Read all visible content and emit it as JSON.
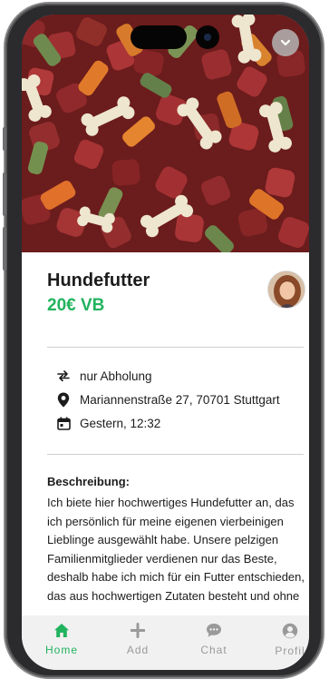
{
  "product": {
    "title": "Hundefutter",
    "price": "20€ VB"
  },
  "info": {
    "pickup": "nur Abholung",
    "address": "Mariannenstraße 27, 70701 Stuttgart",
    "date": "Gestern, 12:32"
  },
  "description": {
    "heading": "Beschreibung:",
    "text": "Ich biete hier hochwertiges Hundefutter an, das ich persönlich für meine eigenen vierbeinigen Lieblinge ausgewählt habe. Unsere pelzigen Familienmitglieder verdienen nur das Beste, deshalb habe ich mich für ein Futter entschieden, das aus hochwertigen Zutaten besteht und ohne"
  },
  "nav": {
    "items": [
      {
        "label": "Home",
        "icon": "home-icon",
        "active": true
      },
      {
        "label": "Add",
        "icon": "plus-icon",
        "active": false
      },
      {
        "label": "Chat",
        "icon": "chat-bubble-icon",
        "active": false
      },
      {
        "label": "Profil",
        "icon": "user-icon",
        "active": false
      }
    ]
  },
  "colors": {
    "accent": "#22b35e",
    "inactive": "#9a9a9a",
    "nav_bg": "#f1f1f1"
  }
}
